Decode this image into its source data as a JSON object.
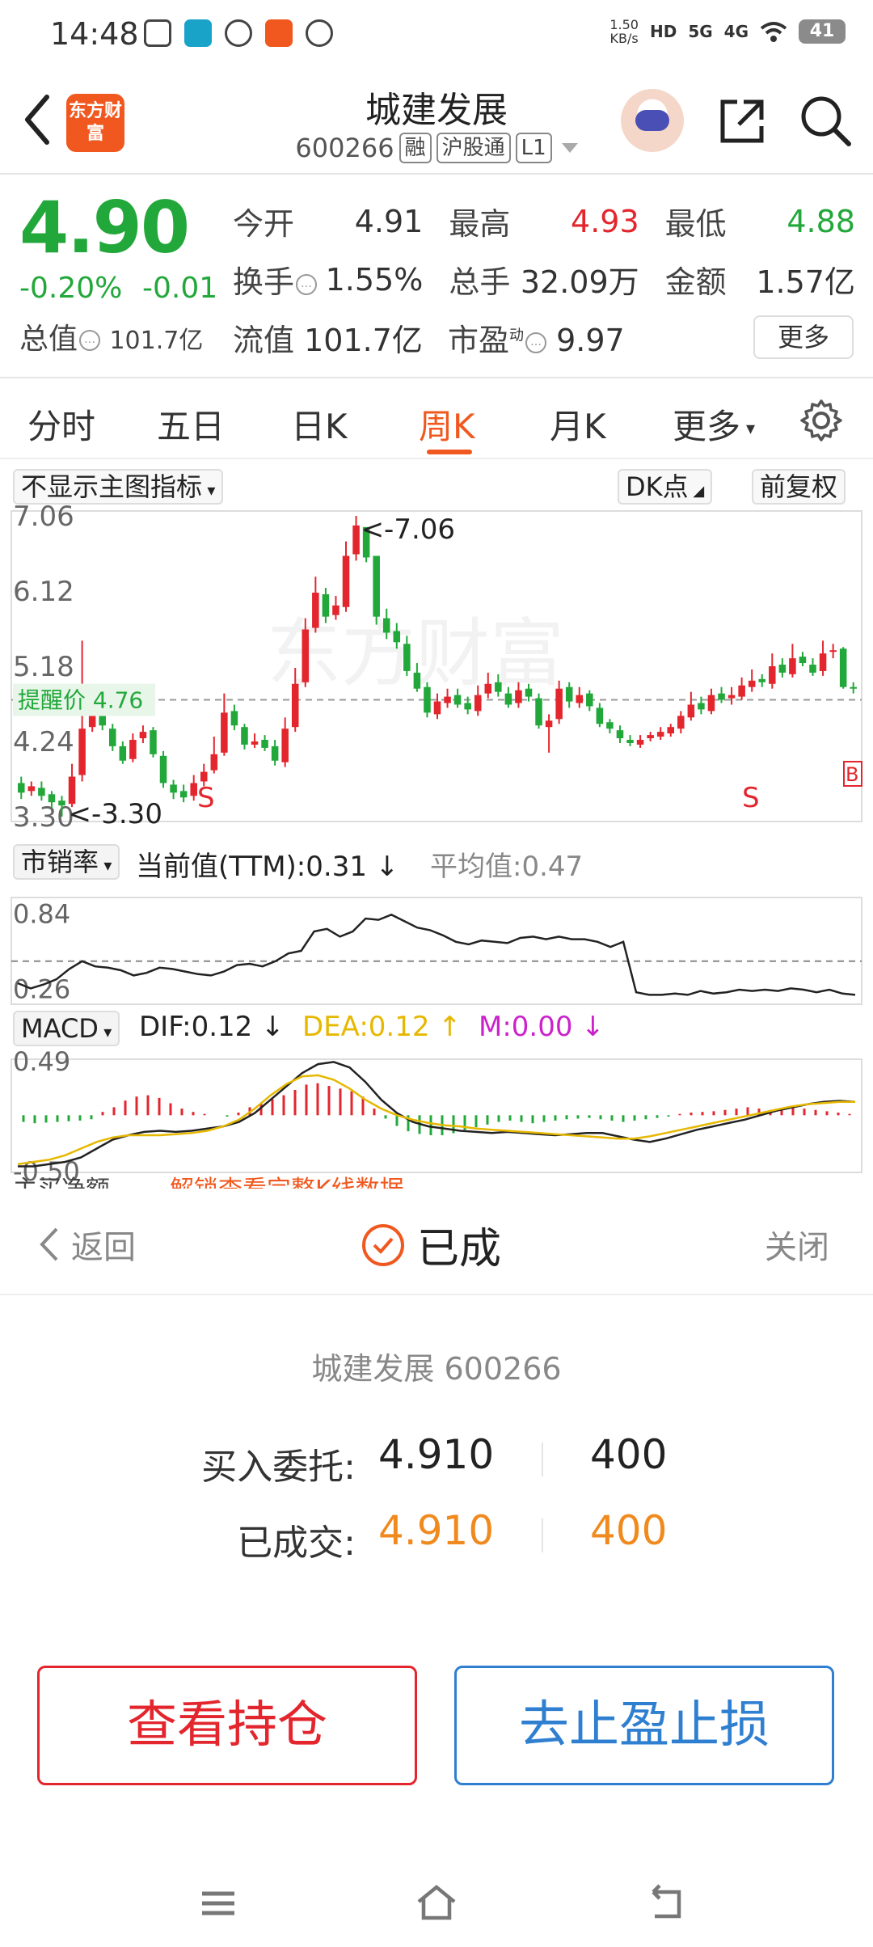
{
  "status_bar": {
    "time": "14:48",
    "net_speed_value": "1.50",
    "net_speed_unit": "KB/s",
    "hd": "HD",
    "net1": "5G",
    "net2": "4G",
    "battery": "41"
  },
  "header": {
    "title": "城建发展",
    "code": "600266",
    "tags": [
      "融",
      "沪股通",
      "L1"
    ],
    "logo_text": "东方财富"
  },
  "quote": {
    "price": "4.90",
    "change_pct": "-0.20%",
    "change_abs": "-0.01",
    "fields": [
      {
        "label": "今开",
        "value": "4.91",
        "color": "#333333"
      },
      {
        "label": "最高",
        "value": "4.93",
        "color": "#e3262e"
      },
      {
        "label": "最低",
        "value": "4.88",
        "color": "#22a83a"
      },
      {
        "label": "换手",
        "value": "1.55%",
        "color": "#333333"
      },
      {
        "label": "总手",
        "value": "32.09万",
        "color": "#333333"
      },
      {
        "label": "金额",
        "value": "1.57亿",
        "color": "#333333"
      }
    ],
    "total_value_label": "总值",
    "total_value": "101.7亿",
    "float_value_label": "流值",
    "float_value": "101.7亿",
    "pe_label": "市盈",
    "pe_sup": "动",
    "pe_value": "9.97",
    "more_label": "更多"
  },
  "tabs": {
    "items": [
      "分时",
      "五日",
      "日K",
      "周K",
      "月K",
      "更多"
    ],
    "active": "周K"
  },
  "chart": {
    "indicator_select": "不显示主图指标",
    "dk_label": "DK点",
    "adjust_label": "前复权",
    "price_axis": [
      "7.06",
      "6.12",
      "5.18",
      "4.24",
      "3.30"
    ],
    "high_marker": "<-7.06",
    "low_marker": "<-3.30",
    "alert_label": "提醒价 4.76",
    "signal_s": "S",
    "signal_b": "B",
    "ps_select": "市销率",
    "ps_current": "当前值(TTM):0.31",
    "ps_avg": "平均值:0.47",
    "ps_axis": [
      "0.84",
      "0.26"
    ],
    "macd_select": "MACD",
    "macd_dif": "DIF:0.12",
    "macd_dea": "DEA:0.12",
    "macd_m": "M:0.00",
    "macd_axis": [
      "0.49",
      "-0.50"
    ],
    "truncated_label": "主买净额",
    "unlock_text": "解锁查看完整K线数据",
    "watermark": "东方财富"
  },
  "chart_data": {
    "type": "candlestick",
    "title": "周K",
    "ylim": [
      3.3,
      7.06
    ],
    "alert_price": 4.76,
    "opens": [
      3.72,
      3.62,
      3.66,
      3.58,
      3.5,
      3.46,
      3.82,
      4.42,
      4.6,
      4.4,
      4.18,
      4.02,
      4.28,
      4.38,
      4.06,
      3.7,
      3.62,
      3.56,
      3.74,
      3.88,
      4.1,
      4.62,
      4.42,
      4.2,
      4.26,
      4.18,
      3.98,
      4.42,
      4.98,
      5.66,
      6.08,
      5.82,
      5.92,
      6.58,
      6.92,
      6.56,
      5.78,
      5.62,
      5.46,
      5.1,
      4.92,
      4.58,
      4.72,
      4.82,
      4.72,
      4.62,
      4.84,
      4.98,
      4.84,
      4.72,
      4.9,
      4.78,
      4.42,
      4.52,
      4.92,
      4.72,
      4.84,
      4.66,
      4.48,
      4.38,
      4.26,
      4.2,
      4.28,
      4.3,
      4.34,
      4.4,
      4.54,
      4.72,
      4.62,
      4.84,
      4.78,
      4.8,
      4.92,
      5.02,
      4.96,
      5.2,
      5.08,
      5.3,
      5.2,
      5.12,
      5.36,
      5.4,
      4.92
    ],
    "closes": [
      3.6,
      3.68,
      3.56,
      3.48,
      3.44,
      3.8,
      4.4,
      4.58,
      4.44,
      4.18,
      4.0,
      4.26,
      4.36,
      4.08,
      3.72,
      3.6,
      3.54,
      3.72,
      3.86,
      4.08,
      4.6,
      4.44,
      4.2,
      4.24,
      4.16,
      4.0,
      4.4,
      4.96,
      5.64,
      6.1,
      5.8,
      5.94,
      6.56,
      6.94,
      6.54,
      5.8,
      5.6,
      5.48,
      5.12,
      4.9,
      4.6,
      4.74,
      4.8,
      4.7,
      4.64,
      4.82,
      4.96,
      4.86,
      4.7,
      4.88,
      4.8,
      4.44,
      4.5,
      4.9,
      4.74,
      4.82,
      4.68,
      4.46,
      4.4,
      4.28,
      4.22,
      4.26,
      4.32,
      4.36,
      4.42,
      4.56,
      4.7,
      4.64,
      4.82,
      4.76,
      4.82,
      4.94,
      5.0,
      4.98,
      5.18,
      5.1,
      5.28,
      5.22,
      5.1,
      5.34,
      5.38,
      4.92,
      4.9
    ],
    "highs": [
      3.8,
      3.74,
      3.74,
      3.62,
      3.56,
      3.96,
      5.5,
      4.8,
      4.66,
      4.46,
      4.24,
      4.34,
      4.44,
      4.42,
      4.12,
      3.76,
      3.7,
      3.82,
      3.96,
      4.3,
      4.84,
      4.7,
      4.46,
      4.34,
      4.32,
      4.26,
      4.54,
      5.16,
      5.78,
      6.3,
      6.16,
      6.06,
      6.74,
      7.06,
      6.78,
      6.3,
      5.9,
      5.72,
      5.56,
      5.22,
      4.98,
      4.84,
      4.9,
      4.9,
      4.8,
      4.94,
      5.1,
      5.08,
      4.92,
      4.98,
      4.96,
      4.84,
      4.58,
      5.0,
      4.98,
      4.92,
      4.88,
      4.72,
      4.52,
      4.44,
      4.32,
      4.32,
      4.36,
      4.42,
      4.46,
      4.62,
      4.86,
      4.8,
      4.9,
      4.92,
      4.92,
      5.04,
      5.14,
      5.08,
      5.34,
      5.28,
      5.46,
      5.36,
      5.28,
      5.5,
      5.46,
      5.42,
      4.98
    ],
    "lows": [
      3.52,
      3.56,
      3.5,
      3.4,
      3.3,
      3.42,
      3.74,
      4.36,
      4.38,
      4.12,
      3.96,
      3.98,
      4.22,
      4.04,
      3.66,
      3.52,
      3.48,
      3.5,
      3.68,
      3.84,
      4.06,
      4.38,
      4.14,
      4.16,
      4.12,
      3.94,
      3.92,
      4.36,
      4.92,
      5.6,
      5.72,
      5.76,
      5.86,
      6.5,
      6.48,
      5.7,
      5.52,
      5.4,
      5.06,
      4.86,
      4.54,
      4.52,
      4.66,
      4.66,
      4.58,
      4.56,
      4.78,
      4.8,
      4.66,
      4.66,
      4.74,
      4.4,
      4.1,
      4.46,
      4.66,
      4.66,
      4.62,
      4.42,
      4.34,
      4.22,
      4.18,
      4.16,
      4.24,
      4.26,
      4.3,
      4.34,
      4.5,
      4.58,
      4.58,
      4.72,
      4.7,
      4.76,
      4.86,
      4.92,
      4.9,
      5.04,
      5.04,
      5.18,
      5.06,
      5.06,
      5.28,
      4.9,
      4.84
    ],
    "ps_series": [
      0.3,
      0.26,
      0.29,
      0.33,
      0.41,
      0.47,
      0.43,
      0.42,
      0.4,
      0.36,
      0.38,
      0.42,
      0.41,
      0.39,
      0.37,
      0.36,
      0.39,
      0.44,
      0.45,
      0.43,
      0.47,
      0.53,
      0.55,
      0.7,
      0.72,
      0.66,
      0.7,
      0.8,
      0.79,
      0.83,
      0.78,
      0.73,
      0.71,
      0.67,
      0.62,
      0.6,
      0.63,
      0.62,
      0.61,
      0.65,
      0.66,
      0.64,
      0.66,
      0.64,
      0.64,
      0.62,
      0.58,
      0.62,
      0.23,
      0.21,
      0.21,
      0.22,
      0.21,
      0.24,
      0.22,
      0.23,
      0.25,
      0.24,
      0.25,
      0.24,
      0.26,
      0.25,
      0.23,
      0.25,
      0.22,
      0.21
    ],
    "ps_ylim": [
      0.15,
      0.95
    ],
    "ps_average": 0.47,
    "macd_ylim": [
      -0.5,
      0.49
    ],
    "macd_hist": [
      -0.1,
      -0.12,
      -0.11,
      -0.1,
      -0.09,
      -0.08,
      -0.06,
      0.05,
      0.12,
      0.22,
      0.28,
      0.3,
      0.26,
      0.18,
      0.1,
      0.05,
      0.02,
      0.0,
      -0.02,
      0.04,
      0.12,
      0.18,
      0.24,
      0.3,
      0.38,
      0.46,
      0.48,
      0.44,
      0.4,
      0.36,
      0.28,
      0.1,
      -0.05,
      -0.16,
      -0.24,
      -0.28,
      -0.3,
      -0.3,
      -0.27,
      -0.22,
      -0.18,
      -0.14,
      -0.1,
      -0.08,
      -0.1,
      -0.12,
      -0.1,
      -0.08,
      -0.06,
      -0.05,
      -0.04,
      -0.06,
      -0.08,
      -0.1,
      -0.08,
      -0.06,
      -0.04,
      -0.02,
      0.02,
      0.04,
      0.05,
      0.06,
      0.08,
      0.1,
      0.12,
      0.1,
      0.08,
      0.1,
      0.12,
      0.1,
      0.08,
      0.06,
      0.04,
      0.02
    ],
    "dif_series": [
      -0.46,
      -0.46,
      -0.44,
      -0.42,
      -0.38,
      -0.3,
      -0.22,
      -0.18,
      -0.15,
      -0.14,
      -0.15,
      -0.14,
      -0.12,
      -0.1,
      -0.06,
      0.02,
      0.14,
      0.26,
      0.38,
      0.46,
      0.48,
      0.43,
      0.3,
      0.14,
      0.02,
      -0.06,
      -0.1,
      -0.12,
      -0.14,
      -0.15,
      -0.16,
      -0.15,
      -0.16,
      -0.17,
      -0.18,
      -0.17,
      -0.16,
      -0.16,
      -0.19,
      -0.22,
      -0.24,
      -0.21,
      -0.17,
      -0.13,
      -0.1,
      -0.07,
      -0.04,
      0.0,
      0.04,
      0.07,
      0.1,
      0.12,
      0.13,
      0.12
    ],
    "dea_series": [
      -0.44,
      -0.42,
      -0.4,
      -0.36,
      -0.3,
      -0.24,
      -0.2,
      -0.18,
      -0.18,
      -0.18,
      -0.17,
      -0.16,
      -0.14,
      -0.1,
      -0.04,
      0.06,
      0.18,
      0.28,
      0.35,
      0.36,
      0.32,
      0.24,
      0.14,
      0.06,
      0.0,
      -0.04,
      -0.07,
      -0.09,
      -0.1,
      -0.12,
      -0.13,
      -0.14,
      -0.15,
      -0.16,
      -0.17,
      -0.18,
      -0.19,
      -0.2,
      -0.21,
      -0.21,
      -0.19,
      -0.16,
      -0.13,
      -0.1,
      -0.07,
      -0.04,
      -0.01,
      0.02,
      0.05,
      0.08,
      0.1,
      0.11,
      0.12,
      0.12
    ]
  },
  "sheet": {
    "back_label": "返回",
    "status_label": "已成",
    "close_label": "关闭",
    "stock": "城建发展 600266",
    "buy_label": "买入委托:",
    "buy_price": "4.910",
    "buy_qty": "400",
    "done_label": "已成交:",
    "done_price": "4.910",
    "done_qty": "400",
    "btn_position": "查看持仓",
    "btn_stop": "去止盈止损"
  },
  "colors": {
    "up": "#e3262e",
    "down": "#22a83a",
    "accent": "#f0581f",
    "blue": "#2f7fd1",
    "dea": "#e6b800",
    "macd_m": "#cc22cc"
  }
}
